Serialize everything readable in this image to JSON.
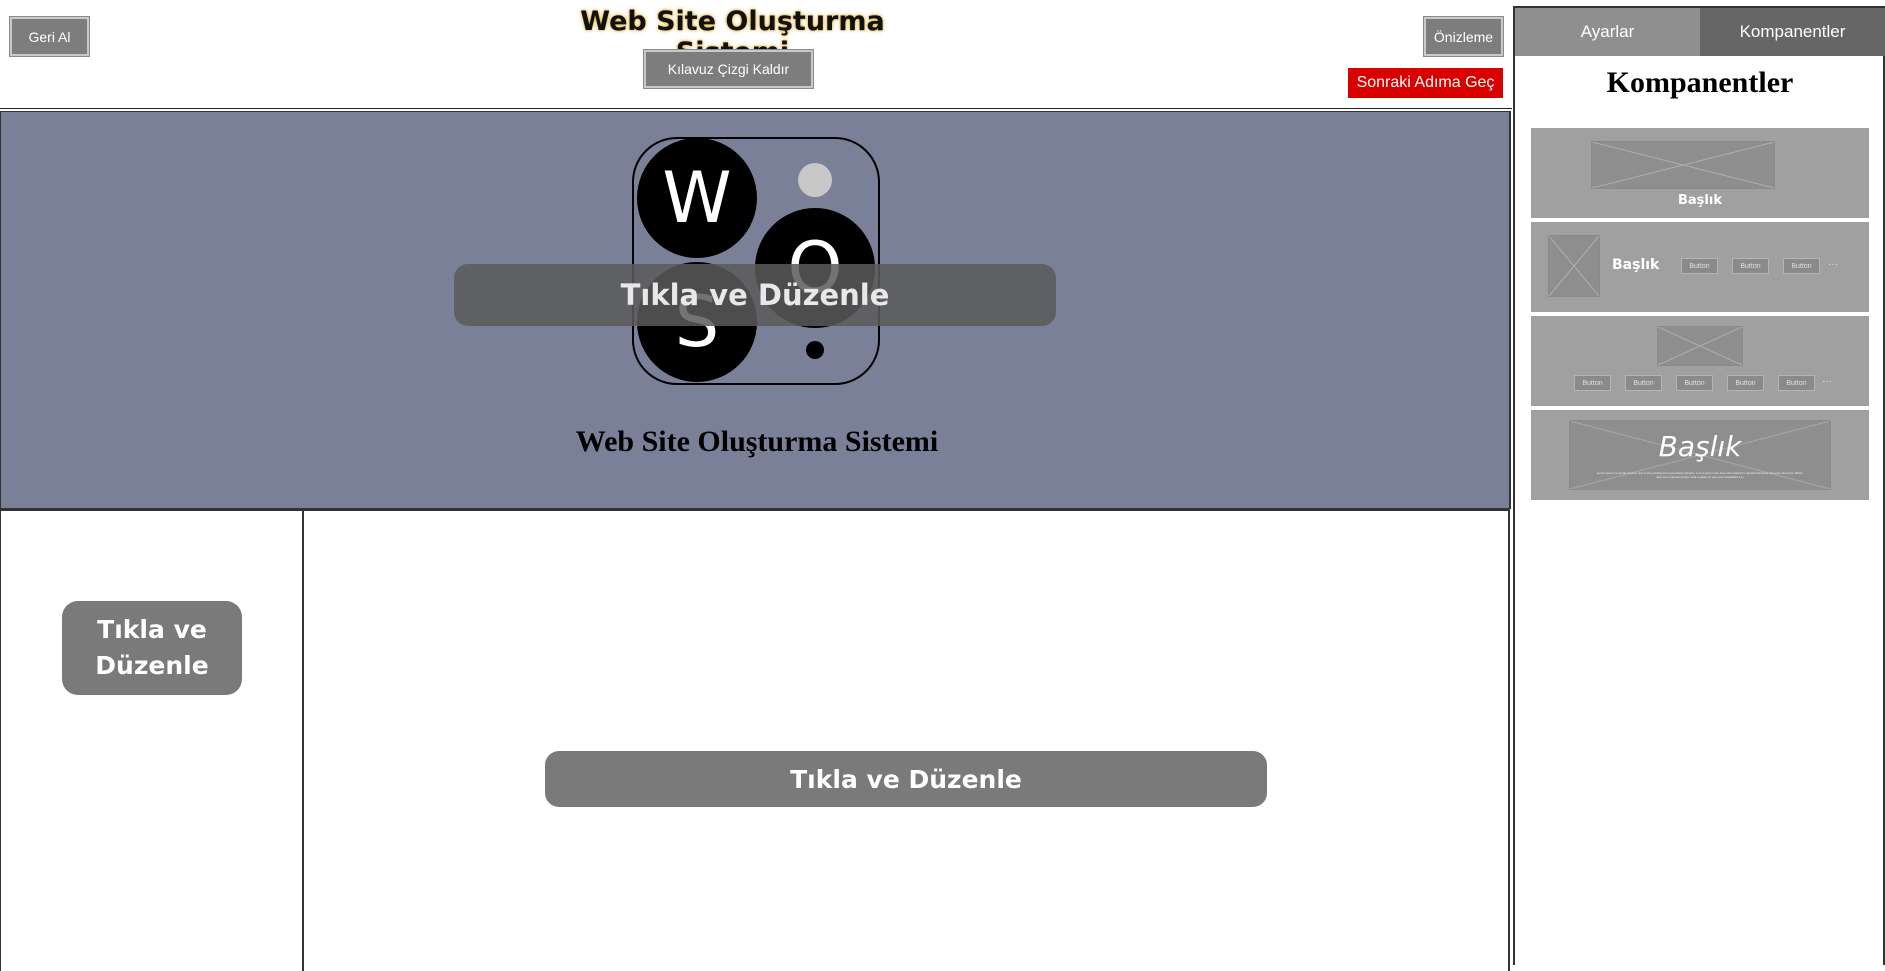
{
  "toolbar": {
    "title": "Web Site Oluşturma Sistemi",
    "undo_label": "Geri Al",
    "guide_label": "Kılavuz Çizgi Kaldır",
    "preview_label": "Önizleme",
    "next_label": "Sonraki Adıma Geç"
  },
  "canvas": {
    "hero": {
      "logo_letters": [
        "W",
        "O",
        "S"
      ],
      "edit_label": "Tıkla ve Düzenle",
      "title": "Web Site Oluşturma Sistemi",
      "background_color": "#7a8098"
    },
    "sidebar_edit_label": "Tıkla ve Düzenle",
    "main_edit_label": "Tıkla ve Düzenle"
  },
  "panel": {
    "tabs": [
      {
        "label": "Ayarlar",
        "active": false
      },
      {
        "label": "Kompanentler",
        "active": true
      }
    ],
    "heading": "Kompanentler",
    "components": [
      {
        "title": "Başlık"
      },
      {
        "title": "Başlık",
        "buttons": [
          "Button",
          "Button",
          "Button"
        ],
        "more": "···"
      },
      {
        "buttons": [
          "Button",
          "Button",
          "Button",
          "Button",
          "Button"
        ],
        "more": "···"
      },
      {
        "title": "Başlık",
        "body": "Lorem Ipsum is simply dummy text of the printing and typesetting industry. Lorem Ipsum has been the industry's standard dummy text ever since the 1500s, when an unknown printer took a galley of type and scrambled it to"
      }
    ]
  },
  "colors": {
    "accent_red": "#d90000",
    "button_gray": "#7d7d7d",
    "hero_bg": "#7a8098"
  }
}
